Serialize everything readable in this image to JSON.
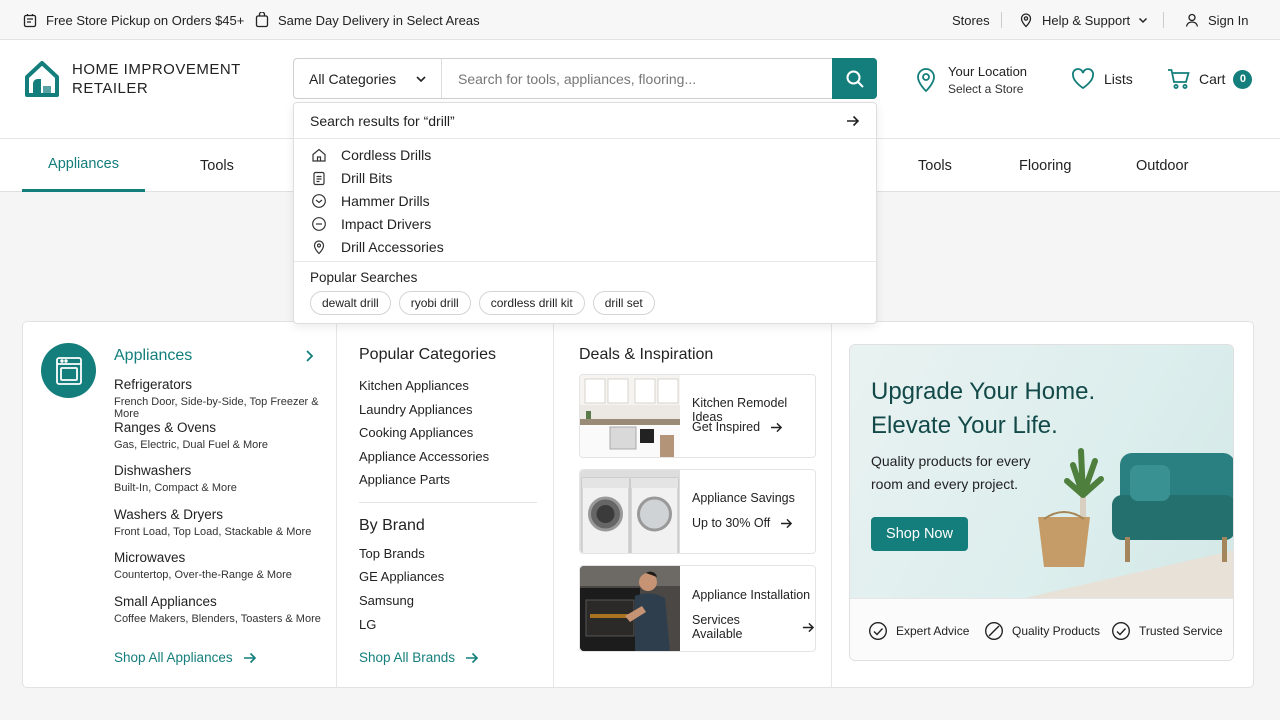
{
  "topbar": {
    "pickup": "Free Store Pickup on Orders $45+",
    "delivery": "Same Day Delivery in Select Areas",
    "stores": "Stores",
    "help": "Help & Support",
    "signin": "Sign In"
  },
  "header": {
    "logo_line1": "HOME IMPROVEMENT",
    "logo_line2": "RETAILER",
    "category": "All Categories",
    "search_placeholder": "Search for tools, appliances, flooring...",
    "location_title": "Your Location",
    "location_sub": "Select a Store",
    "lists": "Lists",
    "cart": "Cart",
    "cart_count": "0"
  },
  "nav": {
    "items": [
      "Appliances",
      "Tools",
      "Tools",
      "Flooring",
      "Outdoor"
    ],
    "active": "Appliances"
  },
  "dropdown": {
    "heading": "Search results for “drill”",
    "results": [
      {
        "label": "Cordless Drills",
        "icon": "home-icon"
      },
      {
        "label": "Drill Bits",
        "icon": "clipboard-icon"
      },
      {
        "label": "Hammer Drills",
        "icon": "circle-chevron-icon"
      },
      {
        "label": "Impact Drivers",
        "icon": "circle-minus-icon"
      },
      {
        "label": "Drill Accessories",
        "icon": "pin-icon"
      }
    ],
    "popular_title": "Popular Searches",
    "popular": [
      "dewalt drill",
      "ryobi drill",
      "cordless drill kit",
      "drill set"
    ]
  },
  "mega": {
    "appliances_title": "Appliances",
    "categories": [
      {
        "name": "Refrigerators",
        "sub": "French Door, Side-by-Side, Top Freezer & More"
      },
      {
        "name": "Ranges & Ovens",
        "sub": "Gas, Electric, Dual Fuel & More"
      },
      {
        "name": "Dishwashers",
        "sub": "Built-In, Compact & More"
      },
      {
        "name": "Washers & Dryers",
        "sub": "Front Load, Top Load, Stackable & More"
      },
      {
        "name": "Microwaves",
        "sub": "Countertop, Over-the-Range & More"
      },
      {
        "name": "Small Appliances",
        "sub": "Coffee Makers, Blenders, Toasters & More"
      }
    ],
    "shop_all_appliances": "Shop All Appliances",
    "popular_title": "Popular Categories",
    "popular": [
      "Kitchen Appliances",
      "Laundry Appliances",
      "Cooking Appliances",
      "Appliance Accessories",
      "Appliance Parts"
    ],
    "brand_title": "By Brand",
    "brands": [
      "Top Brands",
      "GE Appliances",
      "Samsung",
      "LG"
    ],
    "shop_all_brands": "Shop All Brands",
    "deals_title": "Deals & Inspiration",
    "deals": [
      {
        "title": "Kitchen Remodel Ideas",
        "sub": "Get Inspired"
      },
      {
        "title": "Appliance Savings",
        "sub": "Up to 30% Off"
      },
      {
        "title": "Appliance Installation",
        "sub": "Services Available"
      }
    ]
  },
  "promo": {
    "headline1": "Upgrade Your Home.",
    "headline2": "Elevate Your Life.",
    "body1": "Quality products for every",
    "body2": "room and every project.",
    "button": "Shop Now",
    "features": [
      "Expert Advice",
      "Quality Products",
      "Trusted Service"
    ]
  },
  "colors": {
    "accent": "#137e7b",
    "sofa": "#2a7f80"
  }
}
